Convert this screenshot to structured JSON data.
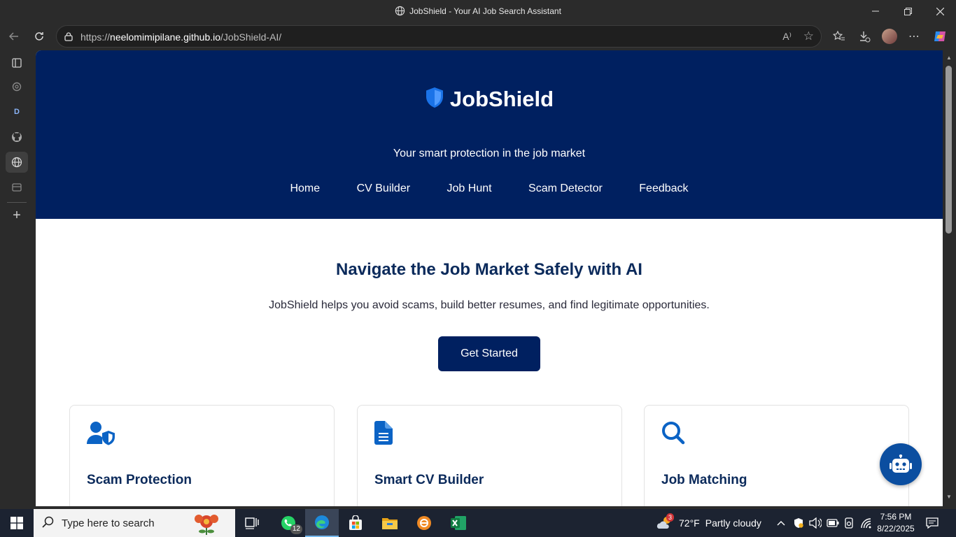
{
  "browser": {
    "window_title": "JobShield - Your AI Job Search Assistant",
    "url_prefix": "https://",
    "url_host": "neelomimipilane.github.io",
    "url_path": "/JobShield-AI/",
    "read_aloud": "A⁾"
  },
  "header": {
    "brand": "JobShield",
    "tagline": "Your smart protection in the job market",
    "nav": [
      "Home",
      "CV Builder",
      "Job Hunt",
      "Scam Detector",
      "Feedback"
    ]
  },
  "hero": {
    "heading": "Navigate the Job Market Safely with AI",
    "lead": "JobShield helps you avoid scams, build better resumes, and find legitimate opportunities.",
    "cta_label": "Get Started"
  },
  "features": [
    {
      "title": "Scam Protection"
    },
    {
      "title": "Smart CV Builder"
    },
    {
      "title": "Job Matching"
    }
  ],
  "sidebar": {
    "d_label": "D"
  },
  "taskbar": {
    "search_placeholder": "Type here to search",
    "whatsapp_badge": "12",
    "weather_badge": "3",
    "weather_temp": "72°F",
    "weather_text": "Partly cloudy",
    "time": "7:56 PM",
    "date": "8/22/2025"
  },
  "colors": {
    "hero_bg": "#002060",
    "heading": "#0b2a5b",
    "icon_blue": "#0b63c5",
    "chatbot_bg": "#0b4ea0"
  }
}
